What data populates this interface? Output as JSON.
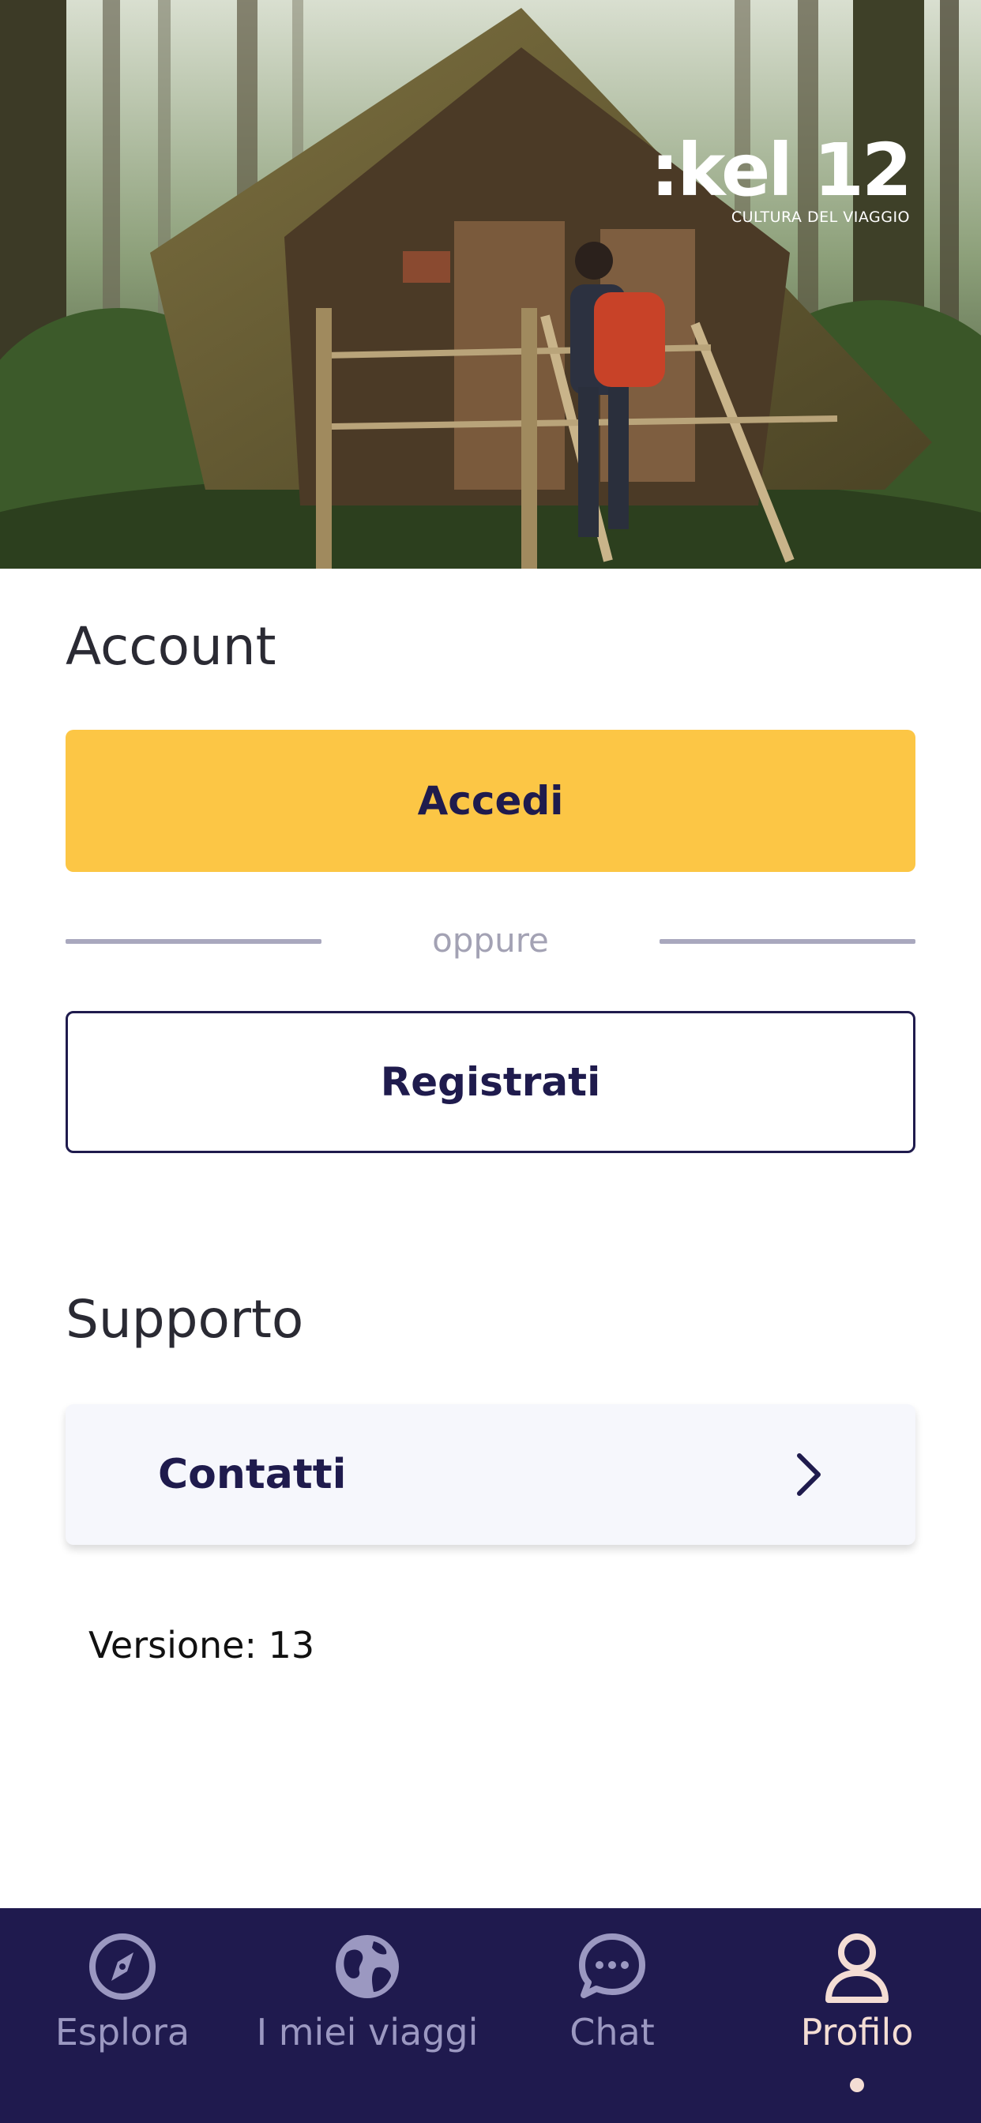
{
  "brand": {
    "logo_text": ":kel 12",
    "tagline": "CULTURA DEL VIAGGIO"
  },
  "account": {
    "title": "Account",
    "login_label": "Accedi",
    "divider_text": "oppure",
    "register_label": "Registrati"
  },
  "support": {
    "title": "Supporto",
    "contacts_label": "Contatti"
  },
  "version_text": "Versione: 13",
  "nav": {
    "items": [
      {
        "label": "Esplora",
        "icon": "compass-icon",
        "active": false
      },
      {
        "label": "I miei viaggi",
        "icon": "globe-icon",
        "active": false
      },
      {
        "label": "Chat",
        "icon": "chat-bubble-icon",
        "active": false
      },
      {
        "label": "Profilo",
        "icon": "user-icon",
        "active": true
      }
    ]
  },
  "colors": {
    "accent_yellow": "#fcc645",
    "navy": "#1f1b4d",
    "nav_background": "#1f1a4e",
    "nav_inactive": "#9b98c1",
    "nav_active": "#f4ddd4"
  }
}
